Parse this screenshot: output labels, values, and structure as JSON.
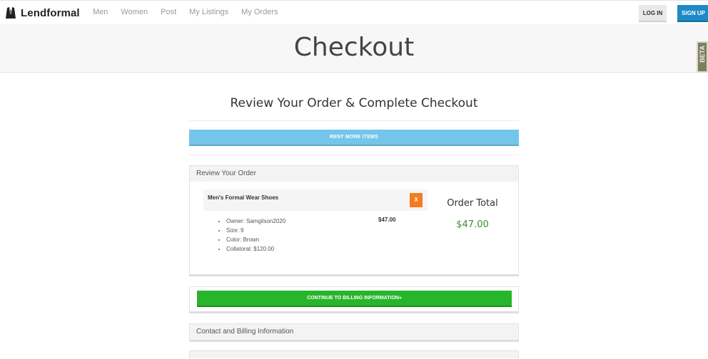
{
  "nav": {
    "brand": "Lendformal",
    "links": [
      "Men",
      "Women",
      "Post",
      "My Listings",
      "My Orders"
    ],
    "login": "LOG IN",
    "signup": "SIGN UP"
  },
  "hero": {
    "title": "Checkout",
    "side_tab": "BETA"
  },
  "main": {
    "subtitle": "Review Your Order & Complete Checkout",
    "rent_more": "RENT MORE ITEMS",
    "review": {
      "heading": "Review Your Order",
      "item": {
        "title": "Men's Formal Wear Shoes",
        "remove": "X",
        "price": "$47.00",
        "details": [
          "Owner: Samgilson2020",
          "Size: 9",
          "Color: Brown",
          "Collatoral: $120.00"
        ]
      },
      "total_label": "Order Total",
      "total_value": "$47.00"
    },
    "continue": "CONTINUE TO BILLING INFORMATION»",
    "billing_heading": "Contact and Billing Information"
  },
  "colors": {
    "signup": "#1f8ac5",
    "rent_more": "#74c5ea",
    "remove": "#f47b20",
    "continue": "#27b52c",
    "total": "#3f8a35"
  }
}
